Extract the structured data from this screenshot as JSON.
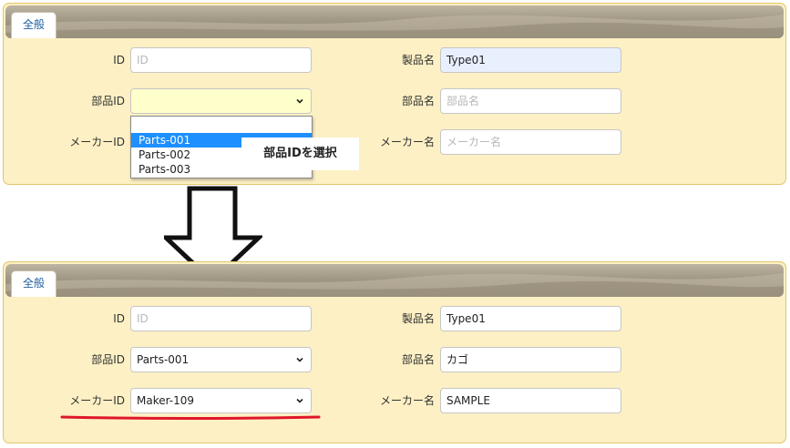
{
  "panels": {
    "tab_label": "全般"
  },
  "fields": {
    "id_label": "ID",
    "id_placeholder": "ID",
    "part_id_label": "部品ID",
    "maker_id_label": "メーカーID",
    "product_name_label": "製品名",
    "part_name_label": "部品名",
    "part_name_placeholder": "部品名",
    "maker_name_label": "メーカー名",
    "maker_name_placeholder": "メーカー名"
  },
  "before": {
    "product_name_value": "Type01",
    "part_id_value": ""
  },
  "dropdown": {
    "options": [
      "Parts-001",
      "Parts-002",
      "Parts-003"
    ],
    "highlighted": "Parts-001"
  },
  "callout": "部品IDを選択",
  "after": {
    "product_name_value": "Type01",
    "part_id_value": "Parts-001",
    "maker_id_value": "Maker-109",
    "part_name_value": "カゴ",
    "maker_name_value": "SAMPLE"
  },
  "colors": {
    "panel_bg": "#fdf0c4",
    "dropdown_highlight": "#1e8ffe",
    "underline": "#e0162b",
    "tab_text": "#1f5f9e"
  }
}
